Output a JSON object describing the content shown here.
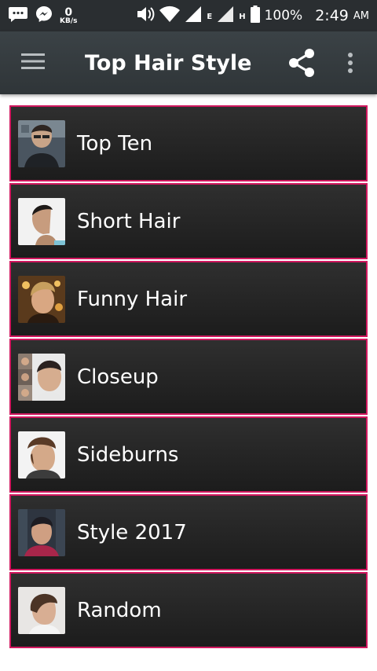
{
  "status_bar": {
    "net_speed_value": "0",
    "net_speed_unit": "KB/s",
    "network_e": "E",
    "network_h": "H",
    "battery": "100%",
    "time": "2:49",
    "ampm": "AM",
    "icons": [
      "message-icon",
      "messenger-icon",
      "volume-icon",
      "wifi-icon",
      "signal-icon",
      "signal-icon",
      "battery-icon"
    ]
  },
  "toolbar": {
    "title": "Top Hair Style",
    "icons": [
      "menu-icon",
      "share-icon",
      "overflow-menu-icon"
    ]
  },
  "categories": [
    {
      "label": "Top Ten"
    },
    {
      "label": "Short Hair"
    },
    {
      "label": "Funny Hair"
    },
    {
      "label": "Closeup"
    },
    {
      "label": "Sideburns"
    },
    {
      "label": "Style 2017"
    },
    {
      "label": "Random"
    }
  ],
  "colors": {
    "toolbar": "#353b3e",
    "statusbar": "#2a2e31",
    "item_border": "#d1185f",
    "item_background": "#262626"
  }
}
